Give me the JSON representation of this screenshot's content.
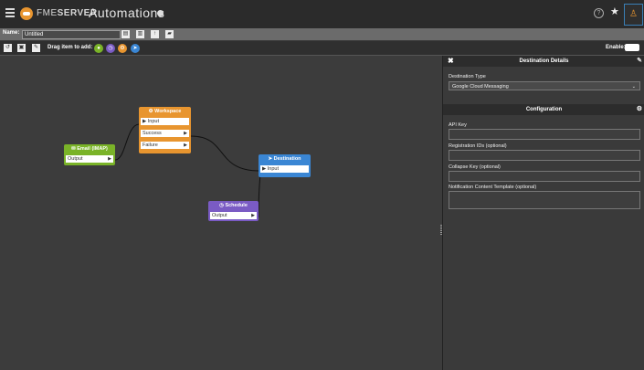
{
  "header": {
    "brand_prefix": "FME",
    "brand_suffix": "SERVER",
    "title": "Automations",
    "user_icon": "user-icon"
  },
  "namebar": {
    "label": "Name:",
    "value": "Untitled"
  },
  "toolbar": {
    "drag_label": "Drag item to add:",
    "enable_label": "Enable:"
  },
  "nodes": {
    "email": {
      "title": "Email (IMAP)",
      "output": "Output",
      "color": "#7ab328"
    },
    "workspace": {
      "title": "Workspace",
      "input": "Input",
      "success": "Success",
      "failure": "Failure",
      "color": "#e8952f"
    },
    "destination": {
      "title": "Destination",
      "input": "Input",
      "color": "#3a86d4"
    },
    "schedule": {
      "title": "Schedule",
      "output": "Output",
      "color": "#7a5bc4"
    }
  },
  "panel": {
    "title": "Destination Details",
    "destination_type_label": "Destination Type",
    "destination_type_value": "Google Cloud Messaging",
    "config_title": "Configuration",
    "fields": [
      {
        "label": "API Key"
      },
      {
        "label": "Registration IDs (optional)"
      },
      {
        "label": "Collapse Key (optional)"
      },
      {
        "label": "Notification Content Template (optional)"
      }
    ]
  }
}
